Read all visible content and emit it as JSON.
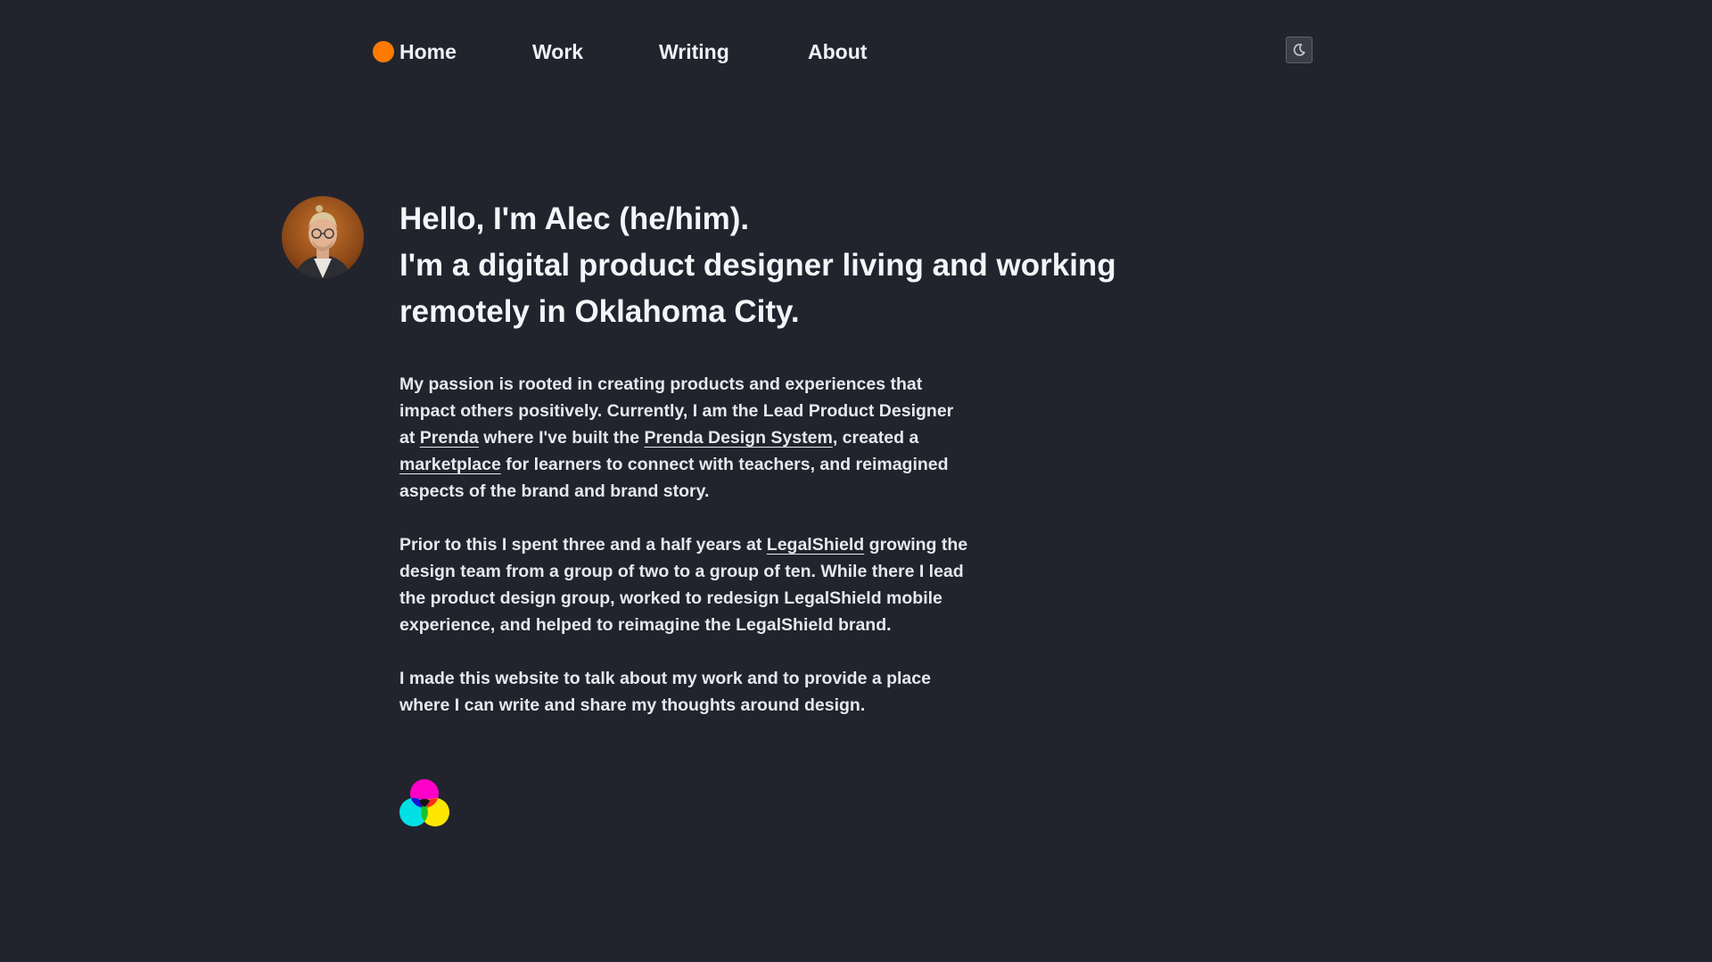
{
  "nav": {
    "home": "Home",
    "work": "Work",
    "writing": "Writing",
    "about": "About",
    "home_dot_color": "#ff7a00",
    "theme_toggle_icon": "moon-icon"
  },
  "hero": {
    "line1": "Hello, I'm Alec (he/him).",
    "line2": "I'm a digital product designer living and working remotely in Oklahoma City."
  },
  "about": {
    "p1": {
      "t1": "My passion is rooted in creating products and experiences that impact others positively. Currently, I am the Lead Product Designer at ",
      "link1": "Prenda",
      "t2": " where I've built the ",
      "link2": "Prenda Design System",
      "t3": ", created a ",
      "link3": "marketplace",
      "t4": " for learners to connect with teachers, and reimagined aspects of the brand and brand story."
    },
    "p2": {
      "t1": "Prior to this I spent three and a half years at ",
      "link1": "LegalShield",
      "t2": " growing the design team from a group of two to a group of ten. While there I lead the product design group, worked to redesign LegalShield mobile experience, and helped to reimagine the LegalShield brand."
    },
    "p3": "I made this website to talk about my work and to provide a place where I can write and share my thoughts around design."
  },
  "colors": {
    "background": "#22242d",
    "text": "#eef0f4",
    "accent": "#ff7a00",
    "logo_magenta": "#ff00c8",
    "logo_cyan": "#00e1e6",
    "logo_yellow": "#ffe600"
  }
}
